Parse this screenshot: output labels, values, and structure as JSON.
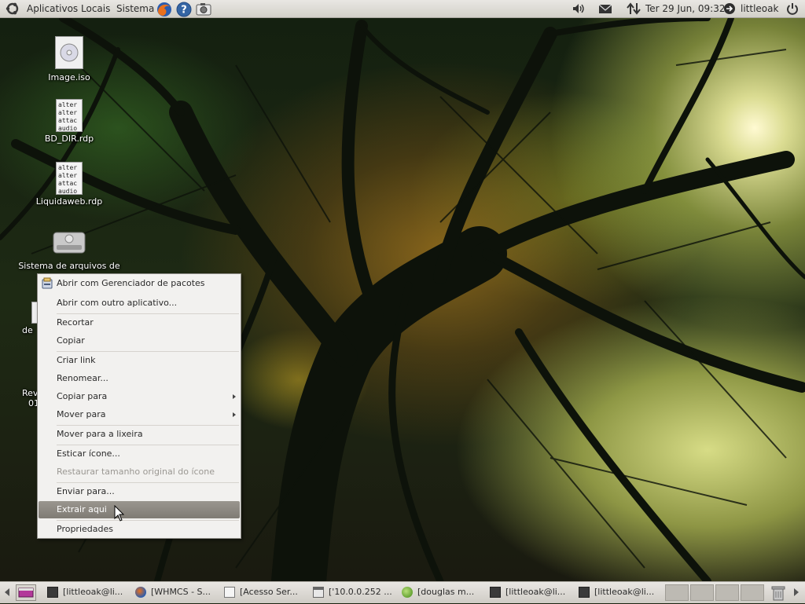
{
  "top_panel": {
    "menus": [
      "Aplicativos",
      "Locais",
      "Sistema"
    ],
    "clock": "Ter 29 Jun, 09:32",
    "user": "littleoak"
  },
  "desktop": {
    "icons": [
      {
        "label": "Image.iso",
        "icon": "disc-image-icon"
      },
      {
        "label": "BD_DIR.rdp",
        "icon": "text-file-icon",
        "preview": [
          "alter",
          "alter",
          "attac",
          "audio"
        ]
      },
      {
        "label": "Liquidaweb.rdp",
        "icon": "text-file-icon",
        "preview": [
          "alter",
          "alter",
          "attac",
          "audio"
        ]
      },
      {
        "label": "Sistema de arquivos de",
        "icon": "hard-drive-icon"
      },
      {
        "label": "de",
        "icon": "file-icon"
      },
      {
        "label": "Rev",
        "icon": "file-icon"
      },
      {
        "label": "01",
        "icon": "file-icon"
      }
    ]
  },
  "context_menu": {
    "items": [
      {
        "label": "Abrir com Gerenciador de pacotes",
        "icon": "package-manager-icon"
      },
      {
        "label": "Abrir com outro aplicativo..."
      },
      {
        "label": "Recortar"
      },
      {
        "label": "Copiar"
      },
      {
        "label": "Criar link"
      },
      {
        "label": "Renomear..."
      },
      {
        "label": "Copiar para"
      },
      {
        "label": "Mover para"
      },
      {
        "label": "Mover para a lixeira"
      },
      {
        "label": "Esticar ícone..."
      },
      {
        "label": "Restaurar tamanho original do ícone",
        "disabled": true
      },
      {
        "label": "Enviar para..."
      },
      {
        "label": "Extrair aqui",
        "highlighted": true
      },
      {
        "label": "Propriedades"
      }
    ]
  },
  "taskbar": {
    "tasks": [
      {
        "label": "[littleoak@li...",
        "icon": "terminal-icon"
      },
      {
        "label": "[WHMCS - S...",
        "icon": "firefox-icon"
      },
      {
        "label": "[Acesso Ser...",
        "icon": "text-editor-icon"
      },
      {
        "label": "['10.0.0.252 ...",
        "icon": "window-icon"
      },
      {
        "label": "[douglas m...",
        "icon": "chat-icon"
      },
      {
        "label": "[littleoak@li...",
        "icon": "terminal-icon"
      },
      {
        "label": "[littleoak@li...",
        "icon": "terminal-icon"
      }
    ]
  },
  "colors": {
    "panel": "#dcdad5",
    "menu_bg": "#f2f1ef",
    "highlight": "#8a867f"
  }
}
